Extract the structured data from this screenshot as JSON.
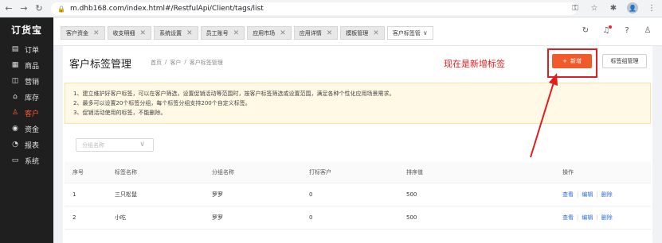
{
  "browser": {
    "url": "m.dhb168.com/index.html#/RestfulApi/Client/tags/list",
    "avatar": "👤"
  },
  "sidebar": {
    "logo": "订货宝",
    "items": [
      {
        "label": "订单",
        "icon": "order-icon"
      },
      {
        "label": "商品",
        "icon": "goods-icon"
      },
      {
        "label": "营销",
        "icon": "marketing-icon"
      },
      {
        "label": "库存",
        "icon": "warehouse-icon"
      },
      {
        "label": "客户",
        "icon": "customer-icon"
      },
      {
        "label": "资金",
        "icon": "money-icon"
      },
      {
        "label": "报表",
        "icon": "report-icon"
      },
      {
        "label": "系统",
        "icon": "system-icon"
      }
    ],
    "active_index": 4
  },
  "tabs": [
    {
      "label": "客户资金"
    },
    {
      "label": "收支明细"
    },
    {
      "label": "系统设置"
    },
    {
      "label": "员工账号"
    },
    {
      "label": "应用市场"
    },
    {
      "label": "应用详情"
    },
    {
      "label": "模板管理"
    },
    {
      "label": "客户标签管"
    }
  ],
  "page": {
    "title": "客户标签管理",
    "breadcrumb": [
      "首页",
      "/",
      "客户",
      "/",
      "客户标签管理"
    ],
    "annotation": "现在是新增标签",
    "new_button": "新增",
    "group_button": "标签组管理"
  },
  "notice": [
    "1、建立维护好客户标签，可以在客户筛选，设置促销活动等范围时，按客户标签筛选或设置范围，满足各种个性化应用场景需求。",
    "2、最多可以设置20个标签分组，每个标签分组支持200个自定义标签。",
    "3、促销活动使用的标签，不能删除。"
  ],
  "filter": {
    "placeholder": "分组名称"
  },
  "table": {
    "headers": [
      "序号",
      "标签名称",
      "分组名称",
      "打标客户",
      "排序值",
      "操作"
    ],
    "rows": [
      {
        "index": "1",
        "name": "三只松鼠",
        "group": "罗罗",
        "count": "0",
        "sort": "500"
      },
      {
        "index": "2",
        "name": "小吃",
        "group": "罗罗",
        "count": "0",
        "sort": "500"
      }
    ],
    "actions": [
      "查看",
      "编辑",
      "删除"
    ]
  },
  "colors": {
    "accent": "#f15a2b",
    "annotation": "#e21d1d",
    "link": "#2f6fd8",
    "sidebar_bg": "#1f1f1f"
  }
}
